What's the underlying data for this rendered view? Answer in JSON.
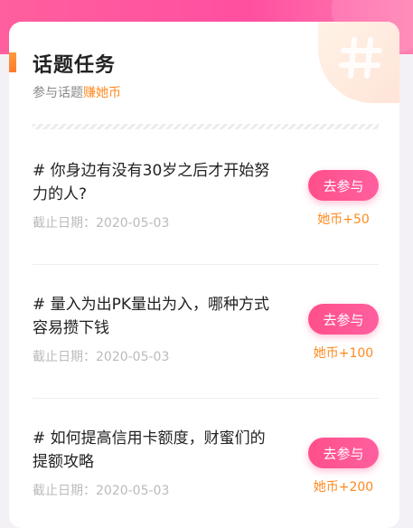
{
  "header": {
    "title": "话题任务",
    "subtitle_prefix": "参与话题",
    "subtitle_highlight": "赚她币",
    "deco_icon": "hash-icon"
  },
  "topics": [
    {
      "text": "# 你身边有没有30岁之后才开始努力的人?",
      "deadline_label": "截止日期：",
      "deadline": "2020-05-03",
      "button_label": "去参与",
      "reward": "她币+50"
    },
    {
      "text": "# 量入为出PK量出为入，哪种方式容易攒下钱",
      "deadline_label": "截止日期：",
      "deadline": "2020-05-03",
      "button_label": "去参与",
      "reward": "她币+100"
    },
    {
      "text": "# 如何提高信用卡额度，财蜜们的提额攻略",
      "deadline_label": "截止日期：",
      "deadline": "2020-05-03",
      "button_label": "去参与",
      "reward": "她币+200"
    }
  ],
  "colors": {
    "accent_orange": "#ff8a1f",
    "button_pink": "#ff4f8b",
    "header_pink": "#ff5f9e"
  }
}
